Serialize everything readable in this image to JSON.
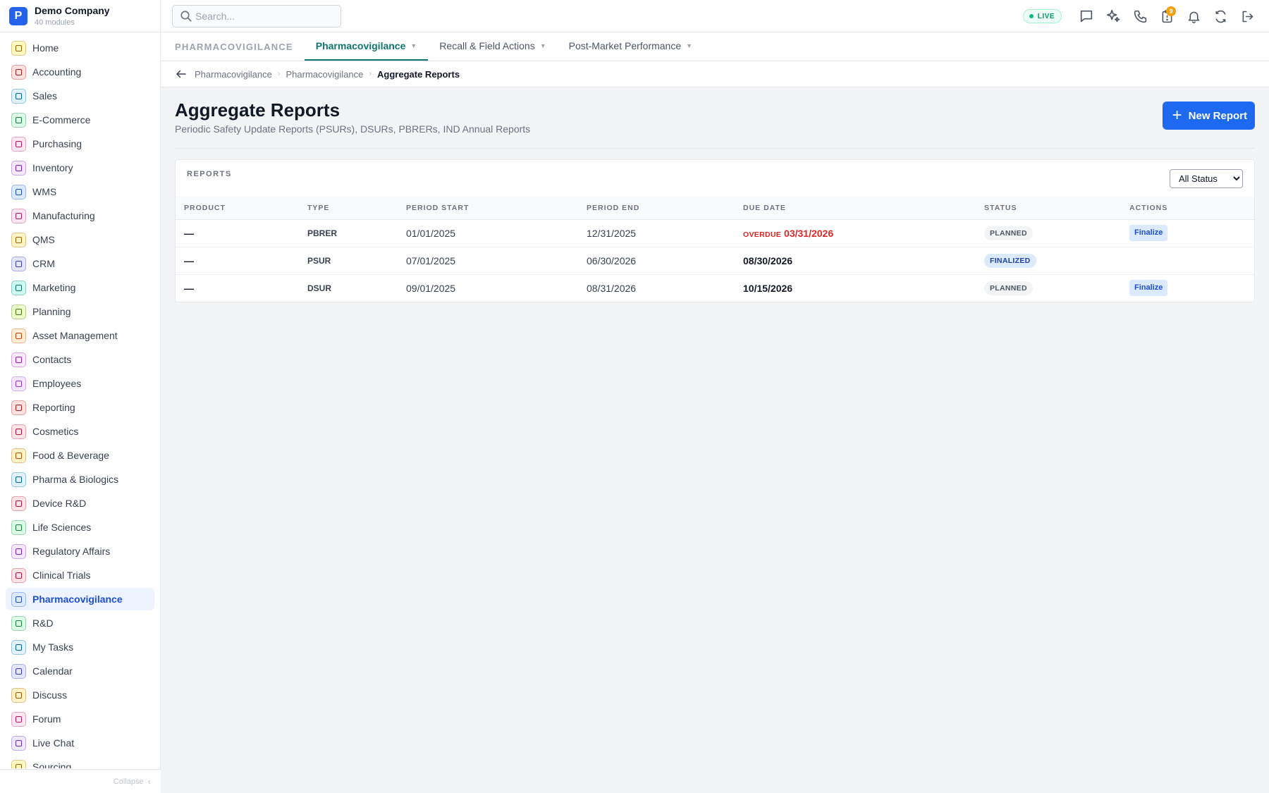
{
  "brand": {
    "name": "Demo Company",
    "subtitle": "40 modules",
    "logo_letter": "P"
  },
  "sidebar": {
    "items": [
      {
        "label": "Home",
        "icon": "home-icon",
        "color": "#a16207",
        "bg": "#fef9c3"
      },
      {
        "label": "Accounting",
        "icon": "bank-icon",
        "color": "#b91c1c",
        "bg": "#fee2e2"
      },
      {
        "label": "Sales",
        "icon": "sales-icon",
        "color": "#0369a1",
        "bg": "#e0f2fe"
      },
      {
        "label": "E-Commerce",
        "icon": "store-icon",
        "color": "#15803d",
        "bg": "#dcfce7"
      },
      {
        "label": "Purchasing",
        "icon": "cart-icon",
        "color": "#be185d",
        "bg": "#fce7f3"
      },
      {
        "label": "Inventory",
        "icon": "box-icon",
        "color": "#7e22ce",
        "bg": "#f3e8ff"
      },
      {
        "label": "WMS",
        "icon": "warehouse-icon",
        "color": "#1d4ed8",
        "bg": "#dbeafe"
      },
      {
        "label": "Manufacturing",
        "icon": "factory-icon",
        "color": "#be185d",
        "bg": "#fce7f3"
      },
      {
        "label": "QMS",
        "icon": "check-badge-icon",
        "color": "#a16207",
        "bg": "#fef3c7"
      },
      {
        "label": "CRM",
        "icon": "users-icon",
        "color": "#4338ca",
        "bg": "#e0e7ff"
      },
      {
        "label": "Marketing",
        "icon": "megaphone-icon",
        "color": "#0f766e",
        "bg": "#ccfbf1"
      },
      {
        "label": "Planning",
        "icon": "clipboard-icon",
        "color": "#4d7c0f",
        "bg": "#ecfccb"
      },
      {
        "label": "Asset Management",
        "icon": "wrench-icon",
        "color": "#c2410c",
        "bg": "#ffedd5"
      },
      {
        "label": "Contacts",
        "icon": "contact-card-icon",
        "color": "#a21caf",
        "bg": "#fae8ff"
      },
      {
        "label": "Employees",
        "icon": "badge-icon",
        "color": "#9333ea",
        "bg": "#f3e8ff"
      },
      {
        "label": "Reporting",
        "icon": "bar-chart-icon",
        "color": "#b91c1c",
        "bg": "#fee2e2"
      },
      {
        "label": "Cosmetics",
        "icon": "lotus-icon",
        "color": "#be123c",
        "bg": "#ffe4e6"
      },
      {
        "label": "Food & Beverage",
        "icon": "utensils-icon",
        "color": "#b45309",
        "bg": "#fef3c7"
      },
      {
        "label": "Pharma & Biologics",
        "icon": "pill-bottle-icon",
        "color": "#0369a1",
        "bg": "#e0f2fe"
      },
      {
        "label": "Device R&D",
        "icon": "device-icon",
        "color": "#be123c",
        "bg": "#ffe4e6"
      },
      {
        "label": "Life Sciences",
        "icon": "microscope-icon",
        "color": "#15803d",
        "bg": "#dcfce7"
      },
      {
        "label": "Regulatory Affairs",
        "icon": "gavel-icon",
        "color": "#7e22ce",
        "bg": "#f3e8ff"
      },
      {
        "label": "Clinical Trials",
        "icon": "clipboard-plus-icon",
        "color": "#be123c",
        "bg": "#ffe4e6"
      },
      {
        "label": "Pharmacovigilance",
        "icon": "shield-icon",
        "color": "#1d4ed8",
        "bg": "#dbeafe",
        "active": true
      },
      {
        "label": "R&D",
        "icon": "flask-icon",
        "color": "#15803d",
        "bg": "#dcfce7"
      },
      {
        "label": "My Tasks",
        "icon": "checklist-icon",
        "color": "#0369a1",
        "bg": "#e0f2fe"
      },
      {
        "label": "Calendar",
        "icon": "calendar-icon",
        "color": "#4338ca",
        "bg": "#e0e7ff"
      },
      {
        "label": "Discuss",
        "icon": "chat-icon",
        "color": "#b45309",
        "bg": "#fef3c7"
      },
      {
        "label": "Forum",
        "icon": "forum-icon",
        "color": "#be185d",
        "bg": "#fce7f3"
      },
      {
        "label": "Live Chat",
        "icon": "headset-icon",
        "color": "#6d28d9",
        "bg": "#ede9fe"
      },
      {
        "label": "Sourcing",
        "icon": "sourcing-icon",
        "color": "#a16207",
        "bg": "#fef9c3"
      }
    ],
    "collapse_label": "Collapse"
  },
  "topbar": {
    "search_placeholder": "Search...",
    "live_label": "LIVE",
    "notification_count": "9",
    "icons": [
      "chat-bubble-icon",
      "sparkles-icon",
      "phone-icon",
      "clipboard-alert-icon",
      "bell-icon",
      "sync-icon",
      "logout-icon"
    ]
  },
  "tabs": {
    "module_label": "PHARMACOVIGILANCE",
    "items": [
      {
        "label": "Pharmacovigilance",
        "active": true
      },
      {
        "label": "Recall & Field Actions"
      },
      {
        "label": "Post-Market Performance"
      }
    ]
  },
  "breadcrumb": [
    "Pharmacovigilance",
    "Pharmacovigilance",
    "Aggregate Reports"
  ],
  "page": {
    "title": "Aggregate Reports",
    "subtitle": "Periodic Safety Update Reports (PSURs), DSURs, PBRERs, IND Annual Reports",
    "new_button": "New Report"
  },
  "reports": {
    "card_title": "REPORTS",
    "filter_selected": "All Status",
    "columns": [
      "PRODUCT",
      "TYPE",
      "PERIOD START",
      "PERIOD END",
      "DUE DATE",
      "STATUS",
      "ACTIONS"
    ],
    "overdue_label": "OVERDUE",
    "rows": [
      {
        "product": "—",
        "type": "PBRER",
        "period_start": "01/01/2025",
        "period_end": "12/31/2025",
        "due_date": "03/31/2026",
        "overdue": true,
        "status": "PLANNED",
        "action": "Finalize"
      },
      {
        "product": "—",
        "type": "PSUR",
        "period_start": "07/01/2025",
        "period_end": "06/30/2026",
        "due_date": "08/30/2026",
        "overdue": false,
        "status": "FINALIZED",
        "action": ""
      },
      {
        "product": "—",
        "type": "DSUR",
        "period_start": "09/01/2025",
        "period_end": "08/31/2026",
        "due_date": "10/15/2026",
        "overdue": false,
        "status": "PLANNED",
        "action": "Finalize"
      }
    ]
  }
}
